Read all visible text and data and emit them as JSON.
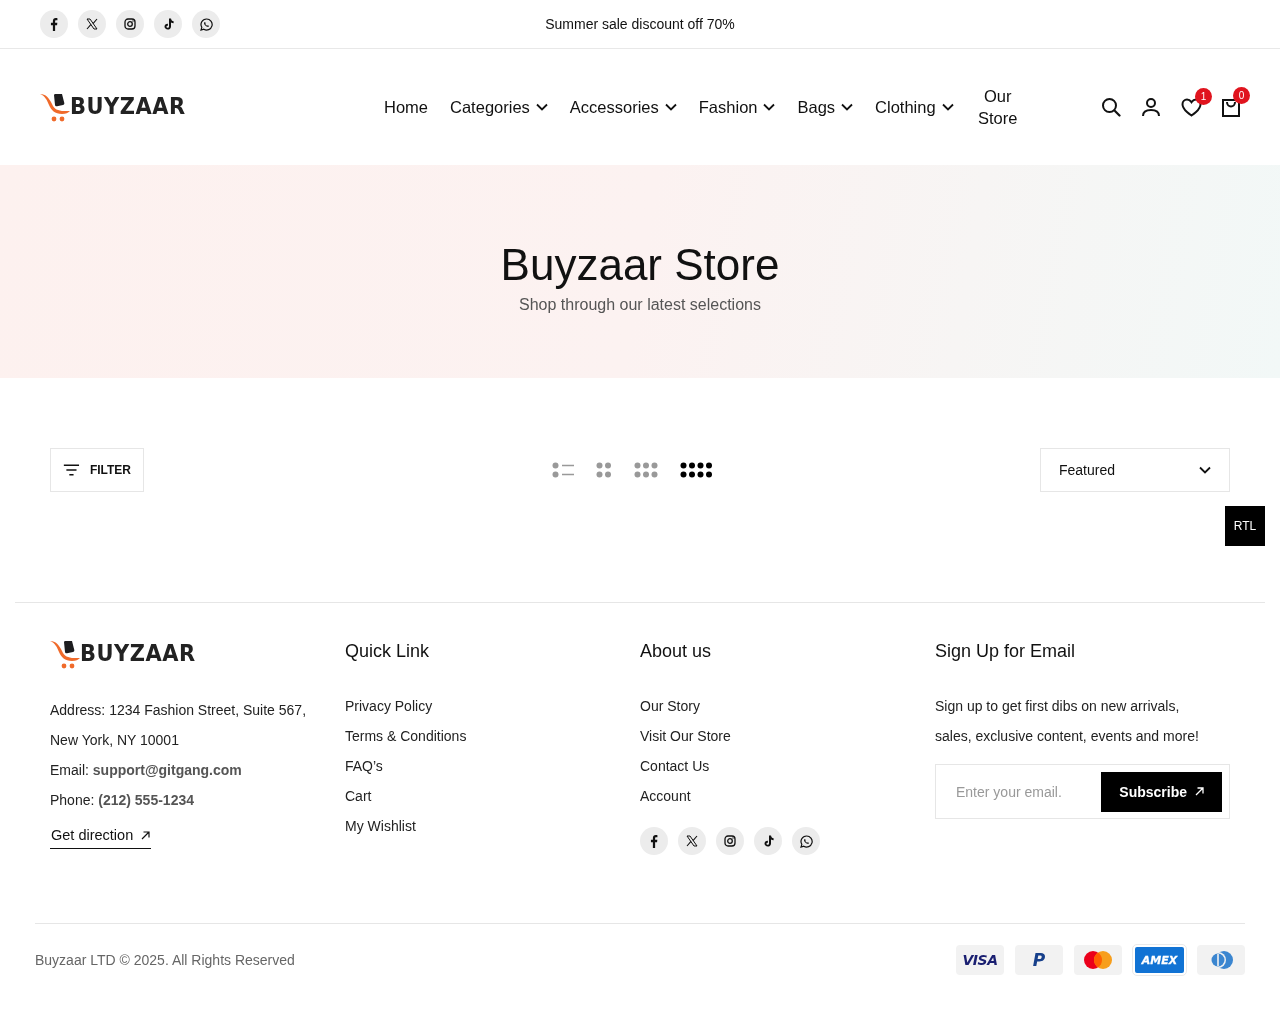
{
  "top_bar": {
    "socials": [
      {
        "kind": "facebook"
      },
      {
        "kind": "x"
      },
      {
        "kind": "instagram"
      },
      {
        "kind": "tiktok"
      },
      {
        "kind": "whatsapp"
      }
    ],
    "announcement": "Summer sale discount off 70%"
  },
  "header": {
    "logo": "BUYZAAR",
    "nav": [
      {
        "label": "Home",
        "dropdown": false
      },
      {
        "label": "Categories",
        "dropdown": true
      },
      {
        "label": "Accessories",
        "dropdown": true
      },
      {
        "label": "Fashion",
        "dropdown": true
      },
      {
        "label": "Bags",
        "dropdown": true
      },
      {
        "label": "Clothing",
        "dropdown": true
      },
      {
        "label": "Our Store",
        "dropdown": false
      }
    ],
    "actions": [
      {
        "kind": "search"
      },
      {
        "kind": "account"
      },
      {
        "kind": "wishlist",
        "badge": "1"
      },
      {
        "kind": "cart",
        "badge": "0"
      }
    ]
  },
  "hero": {
    "title": "Buyzaar Store",
    "subtitle": "Shop through our latest selections"
  },
  "toolbar": {
    "filter": "FILTER",
    "views": [
      {
        "kind": "list",
        "selected": false
      },
      {
        "kind": "grid2",
        "selected": false
      },
      {
        "kind": "grid3",
        "selected": false
      },
      {
        "kind": "grid4",
        "selected": true
      }
    ],
    "sort": "Featured"
  },
  "rtl_button": "RTL",
  "footer": {
    "logo": "BUYZAAR",
    "contact": [
      "Address: 1234 Fashion Street, Suite 567, New York, NY 10001",
      "Email: **support@gitgang.com**",
      "Phone: **(212) 555-1234**"
    ],
    "direction_link": "Get direction",
    "columns": [
      {
        "title": "Quick Link",
        "links": [
          "Privacy Policy",
          "Terms & Conditions",
          "FAQ’s",
          "Cart",
          "My Wishlist"
        ]
      },
      {
        "title": "About us",
        "links": [
          "Our Story",
          "Visit Our Store",
          "Contact Us",
          "Account"
        ]
      }
    ],
    "socials": [
      {
        "kind": "facebook"
      },
      {
        "kind": "x"
      },
      {
        "kind": "instagram"
      },
      {
        "kind": "tiktok"
      },
      {
        "kind": "whatsapp"
      }
    ],
    "signup": {
      "title": "Sign Up for Email",
      "text": "Sign up to get first dibs on new arrivals, sales, exclusive content, events and more!",
      "placeholder": "Enter your email.",
      "button": "Subscribe"
    },
    "copyright": "Buyzaar LTD © 2025. All Rights Reserved",
    "payments": [
      {
        "kind": "visa",
        "label": "VISA"
      },
      {
        "kind": "paypal",
        "label": "P"
      },
      {
        "kind": "mastercard"
      },
      {
        "kind": "amex",
        "label": "AMEX"
      },
      {
        "kind": "diners"
      }
    ]
  }
}
